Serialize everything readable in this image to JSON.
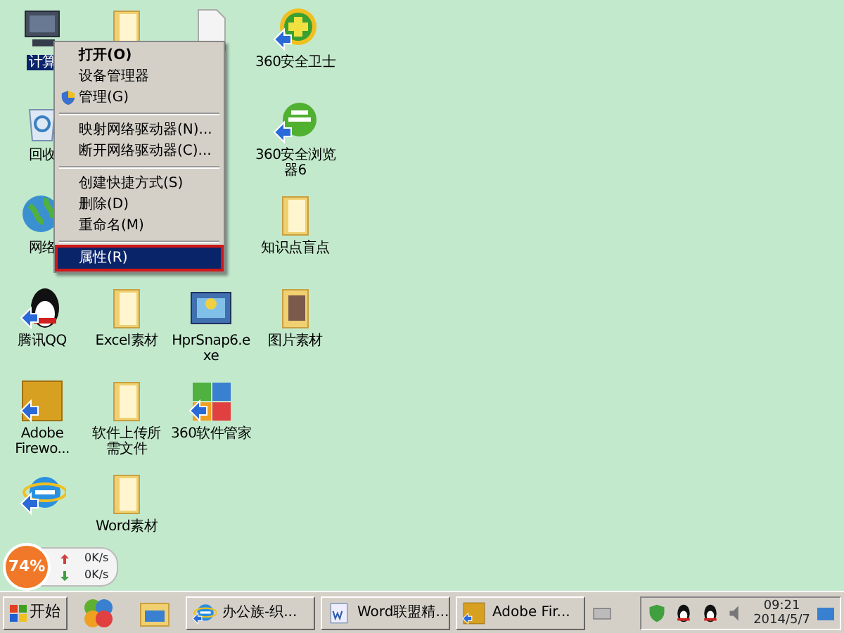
{
  "desktop_icons": [
    {
      "kind": "computer",
      "label": "计算",
      "selected": true
    },
    {
      "kind": "folder",
      "selected": false
    },
    {
      "kind": "document",
      "selected": false
    },
    {
      "kind": "guard",
      "label": "360安全卫士",
      "selected": false
    },
    {
      "kind": "recycle",
      "label": "回收",
      "selected": false
    },
    {
      "kind": "browser",
      "label": "360安全浏览器6",
      "selected": false
    },
    {
      "kind": "network",
      "label": "网络",
      "selected": false
    },
    {
      "kind": "folder",
      "label": "知识点盲点",
      "selected": false
    },
    {
      "kind": "qq",
      "label": "腾讯QQ",
      "selected": false
    },
    {
      "kind": "folder",
      "label": "Excel素材",
      "selected": false
    },
    {
      "kind": "snap",
      "label": "HprSnap6.exe",
      "selected": false
    },
    {
      "kind": "photofolder",
      "label": "图片素材",
      "selected": false
    },
    {
      "kind": "fw",
      "label": "Adobe Firewo...",
      "selected": false
    },
    {
      "kind": "folder",
      "label": "软件上传所需文件",
      "selected": false
    },
    {
      "kind": "manager",
      "label": "360软件管家",
      "selected": false
    },
    {
      "kind": "ie",
      "selected": false
    },
    {
      "kind": "folder",
      "label": "Word素材",
      "selected": false
    }
  ],
  "context_menu": {
    "groups": [
      [
        {
          "label": "打开(O)",
          "bold": true,
          "shield": false,
          "selected": false
        },
        {
          "label": "设备管理器",
          "bold": false,
          "shield": false,
          "selected": false
        },
        {
          "label": "管理(G)",
          "bold": false,
          "shield": true,
          "selected": false
        }
      ],
      [
        {
          "label": "映射网络驱动器(N)...",
          "bold": false,
          "shield": false,
          "selected": false
        },
        {
          "label": "断开网络驱动器(C)...",
          "bold": false,
          "shield": false,
          "selected": false
        }
      ],
      [
        {
          "label": "创建快捷方式(S)",
          "bold": false,
          "shield": false,
          "selected": false
        },
        {
          "label": "删除(D)",
          "bold": false,
          "shield": false,
          "selected": false
        },
        {
          "label": "重命名(M)",
          "bold": false,
          "shield": false,
          "selected": false
        }
      ],
      [
        {
          "label": "属性(R)",
          "bold": false,
          "shield": false,
          "selected": true
        }
      ]
    ]
  },
  "speed_widget": {
    "percent": "74%",
    "upload": "0K/s",
    "download": "0K/s"
  },
  "taskbar": {
    "start": "开始",
    "tasks": [
      {
        "kind": "ie",
        "label": "办公族-织..."
      },
      {
        "kind": "word",
        "label": "Word联盟精..."
      },
      {
        "kind": "fw",
        "label": "Adobe Fir..."
      }
    ],
    "clock": {
      "time": "09:21",
      "date": "2014/5/7"
    }
  }
}
